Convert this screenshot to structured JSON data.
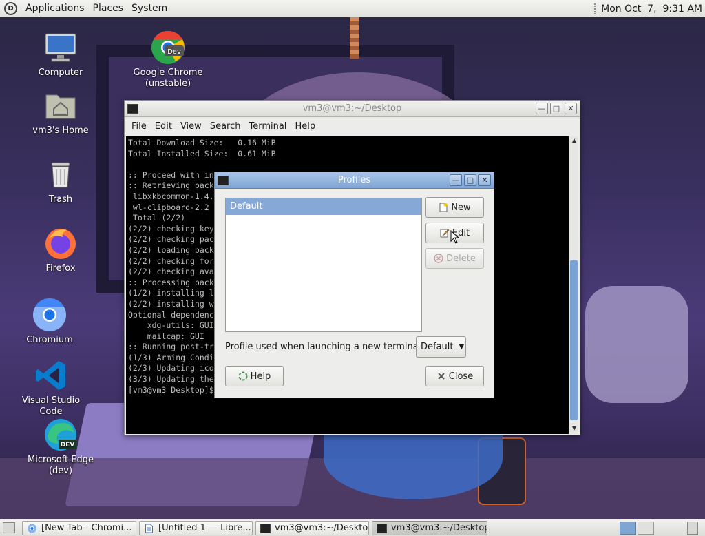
{
  "top_panel": {
    "menus": [
      "Applications",
      "Places",
      "System"
    ],
    "clock": "Mon Oct  7,  9:31 AM"
  },
  "desktop_icons": [
    {
      "label": "Computer",
      "icon": "computer-icon"
    },
    {
      "label": "Google Chrome (unstable)",
      "icon": "chrome-dev-icon"
    },
    {
      "label": "vm3's Home",
      "icon": "home-folder-icon"
    },
    {
      "label": "Trash",
      "icon": "trash-icon"
    },
    {
      "label": "Firefox",
      "icon": "firefox-icon"
    },
    {
      "label": "Chromium",
      "icon": "chromium-icon"
    },
    {
      "label": "Visual Studio Code",
      "icon": "vscode-icon"
    },
    {
      "label": "Microsoft Edge (dev)",
      "icon": "edge-dev-icon"
    }
  ],
  "terminal": {
    "title": "vm3@vm3:~/Desktop",
    "menu": [
      "File",
      "Edit",
      "View",
      "Search",
      "Terminal",
      "Help"
    ],
    "lines": [
      "Total Download Size:   0.16 MiB",
      "Total Installed Size:  0.61 MiB",
      "",
      ":: Proceed with installation? [Y/n]",
      ":: Retrieving packages...",
      " libxkbcommon-1.4.1 ...                      ######## 100%",
      " wl-clipboard-2.2 ...                        ######## 100%",
      " Total (2/2)                                 ######## 100%",
      "(2/2) checking keys in keyring               ######## 100%",
      "(2/2) checking package integrity             ######## 100%",
      "(2/2) loading package files                  ######## 100%",
      "(2/2) checking for file conflicts            ######## 100%",
      "(2/2) checking available disk space          ######## 100%",
      ":: Processing package changes...",
      "(1/2) installing libxkbcommon                ######## 100%",
      "(2/2) installing wl-clipboard                ######## 100%",
      "Optional dependencies for wl-clipboard",
      "    xdg-utils: GUI",
      "    mailcap: GUI",
      ":: Running post-transaction hooks...",
      "(1/3) Arming ConditionNeedsUpdate...",
      "(2/3) Updating icon theme caches...",
      "(3/3) Updating the desktop file MIME type cache...",
      "[vm3@vm3 Desktop]$ "
    ]
  },
  "profiles_dialog": {
    "title": "Profiles",
    "list_items": [
      "Default"
    ],
    "buttons": {
      "new": "New",
      "edit": "Edit",
      "delete": "Delete",
      "help": "Help",
      "close": "Close"
    },
    "launch_label": "Profile used when launching a new terminal:",
    "launch_value": "Default"
  },
  "taskbar": [
    {
      "label": "[New Tab - Chromi...",
      "icon": "chromium-icon",
      "active": false
    },
    {
      "label": "[Untitled 1 — Libre...",
      "icon": "document-icon",
      "active": false
    },
    {
      "label": "vm3@vm3:~/Desktop",
      "icon": "terminal-icon",
      "active": false
    },
    {
      "label": "vm3@vm3:~/Desktop",
      "icon": "terminal-icon",
      "active": true
    }
  ]
}
